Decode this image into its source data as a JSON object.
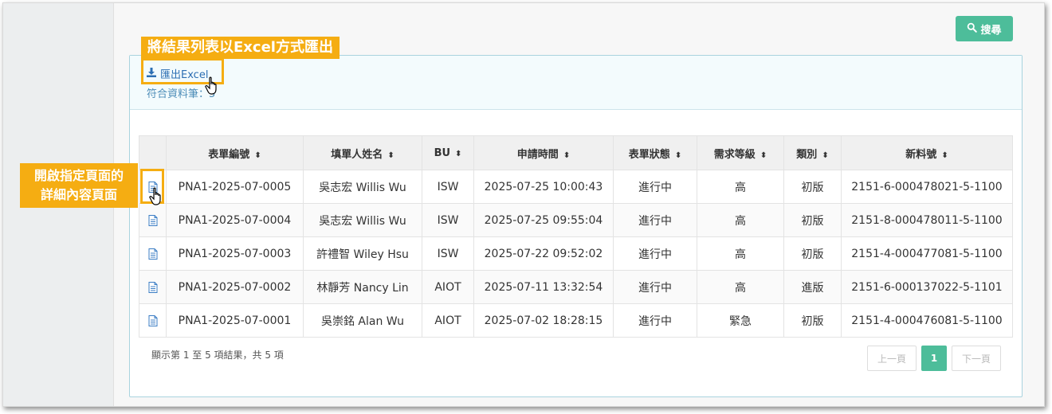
{
  "toolbar": {
    "search_label": "搜尋",
    "search_icon": "search-icon"
  },
  "export": {
    "label": "匯出Excel",
    "count_label": "符合資料筆",
    "count_sep": "：",
    "count_value": "5",
    "icon": "download-icon"
  },
  "table": {
    "headers": [
      "表單編號",
      "填單人姓名",
      "BU",
      "申請時間",
      "表單狀態",
      "需求等級",
      "類別",
      "新料號"
    ],
    "sort_icon": "⇕",
    "rows": [
      [
        "PNA1-2025-07-0005",
        "吳志宏 Willis Wu",
        "ISW",
        "2025-07-25 10:00:43",
        "進行中",
        "高",
        "初版",
        "2151-6-000478021-5-1100"
      ],
      [
        "PNA1-2025-07-0004",
        "吳志宏 Willis Wu",
        "ISW",
        "2025-07-25 09:55:04",
        "進行中",
        "高",
        "初版",
        "2151-8-000478011-5-1100"
      ],
      [
        "PNA1-2025-07-0003",
        "許禮智 Wiley Hsu",
        "ISW",
        "2025-07-22 09:52:02",
        "進行中",
        "高",
        "初版",
        "2151-4-000477081-5-1100"
      ],
      [
        "PNA1-2025-07-0002",
        "林靜芳 Nancy Lin",
        "AIOT",
        "2025-07-11 13:32:54",
        "進行中",
        "高",
        "進版",
        "2151-6-000137022-5-1101"
      ],
      [
        "PNA1-2025-07-0001",
        "吳崇銘 Alan Wu",
        "AIOT",
        "2025-07-02 18:28:15",
        "進行中",
        "緊急",
        "初版",
        "2151-4-000476081-5-1100"
      ]
    ]
  },
  "footer": {
    "info": "顯示第 1 至 5 項結果，共 5 項",
    "prev": "上一頁",
    "current": "1",
    "next": "下一頁"
  },
  "callouts": {
    "export": "將結果列表以Excel方式匯出",
    "detail_line1": "開啟指定頁面的",
    "detail_line2": "詳細內容頁面"
  },
  "colors": {
    "accent": "#4dbd9a",
    "callout": "#f5ad12",
    "link": "#2d6fb3"
  }
}
